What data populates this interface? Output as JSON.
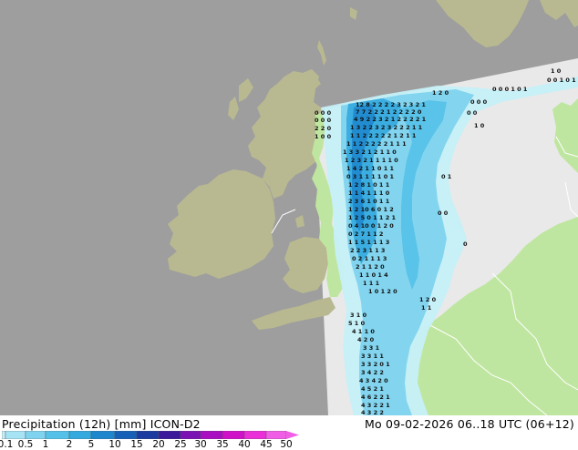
{
  "footer": {
    "title": "Precipitation (12h) [mm] ICON-D2",
    "timestamp": "Mo 09-02-2026 06..18 UTC (06+12)"
  },
  "legend": {
    "ticks": [
      "0.1",
      "0.5",
      "1",
      "2",
      "5",
      "10",
      "15",
      "20",
      "25",
      "30",
      "35",
      "40",
      "45",
      "50"
    ],
    "colors": [
      "#c6f0f8",
      "#a6e3f4",
      "#7fd3ee",
      "#55c1e8",
      "#33a9de",
      "#1e86cc",
      "#1760b8",
      "#1a3aa0",
      "#3a1a9a",
      "#7a12b4",
      "#a90fc0",
      "#cf12c8",
      "#ea2fd8",
      "#f05ee6"
    ]
  },
  "map": {
    "sea_color": "#e9e9e9",
    "outside_domain_color": "#9e9e9e",
    "land_in_domain_color": "#bfe6a0",
    "land_outside_domain_color": "#b9b991",
    "border_color": "#ffffff"
  }
}
